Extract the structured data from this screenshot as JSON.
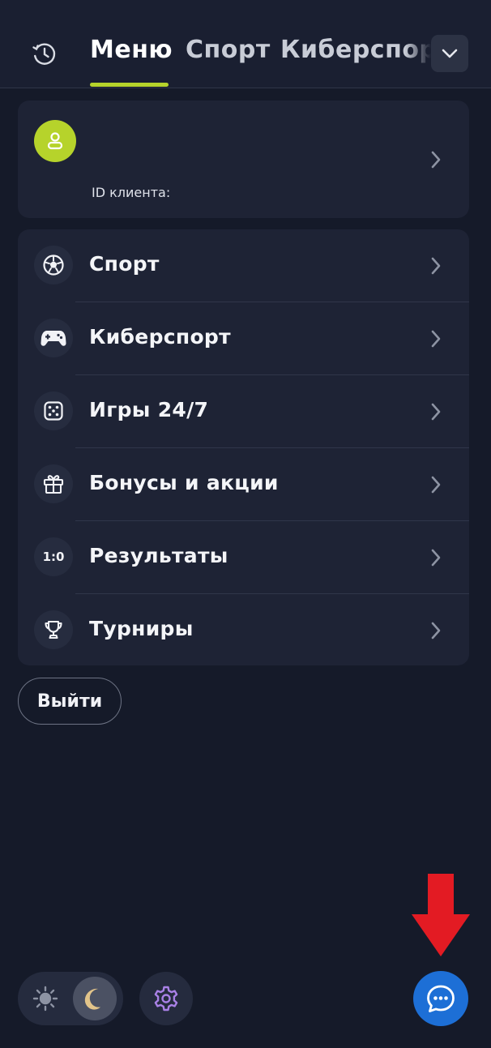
{
  "header": {
    "tabs": [
      {
        "label": "Меню",
        "active": true
      },
      {
        "label": "Спорт",
        "active": false
      },
      {
        "label": "Киберспор",
        "active": false
      }
    ]
  },
  "profile": {
    "client_id_label": "ID клиента:"
  },
  "menu": {
    "items": [
      {
        "label": "Спорт",
        "icon": "soccer-ball-icon"
      },
      {
        "label": "Киберспорт",
        "icon": "gamepad-icon"
      },
      {
        "label": "Игры 24/7",
        "icon": "dice-icon"
      },
      {
        "label": "Бонусы и акции",
        "icon": "gift-icon"
      },
      {
        "label": "Результаты",
        "icon": "score-icon"
      },
      {
        "label": "Турниры",
        "icon": "trophy-icon"
      }
    ],
    "score_icon_text": "1:0"
  },
  "actions": {
    "logout_label": "Выйти"
  },
  "colors": {
    "background": "#151a29",
    "card": "#1e2335",
    "accent": "#b6d32b",
    "chat": "#1d6fd6",
    "annotation_arrow": "#e31b23"
  }
}
